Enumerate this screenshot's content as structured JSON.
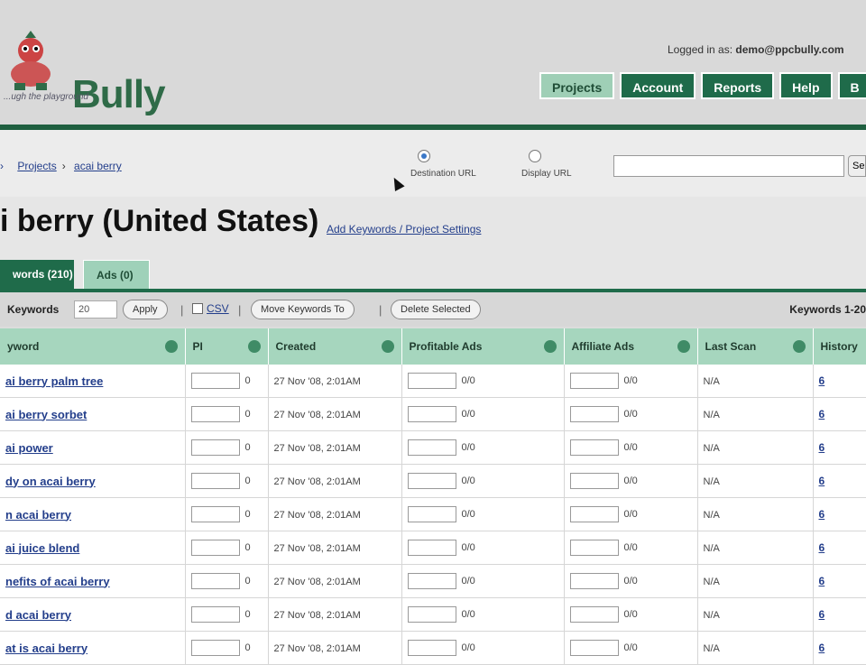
{
  "header": {
    "logo_text": "Bully",
    "logo_tagline": "...ugh the playground",
    "logged_in_label": "Logged in as:",
    "logged_in_user": "demo@ppcbully.com",
    "nav": [
      "Projects",
      "Account",
      "Reports",
      "Help",
      "B"
    ]
  },
  "breadcrumb": {
    "lead": "›",
    "items": [
      "Projects",
      "acai berry"
    ]
  },
  "url_options": {
    "destination_label": "Destination URL",
    "display_label": "Display URL",
    "selected": "Destination URL"
  },
  "search": {
    "placeholder": "",
    "button_label": "Se"
  },
  "page": {
    "title": "i berry (United States)",
    "settings_link": "Add Keywords / Project Settings"
  },
  "tabs": [
    {
      "label": "words (210)",
      "active": true
    },
    {
      "label": "Ads (0)",
      "active": false
    }
  ],
  "toolbar": {
    "keywords_label": "Keywords",
    "per_page_value": "20",
    "apply_label": "Apply",
    "csv_label": "CSV",
    "move_label": "Move Keywords To",
    "delete_label": "Delete Selected",
    "count_label": "Keywords 1-20"
  },
  "table": {
    "columns": [
      "yword",
      "PI",
      "Created",
      "Profitable Ads",
      "Affiliate Ads",
      "Last Scan",
      "History"
    ],
    "rows": [
      {
        "keyword": "ai berry palm tree",
        "pi": "0",
        "created": "27 Nov '08, 2:01AM",
        "profitable": "0/0",
        "affiliate": "0/0",
        "last_scan": "N/A",
        "history": "6"
      },
      {
        "keyword": "ai berry sorbet",
        "pi": "0",
        "created": "27 Nov '08, 2:01AM",
        "profitable": "0/0",
        "affiliate": "0/0",
        "last_scan": "N/A",
        "history": "6"
      },
      {
        "keyword": "ai power",
        "pi": "0",
        "created": "27 Nov '08, 2:01AM",
        "profitable": "0/0",
        "affiliate": "0/0",
        "last_scan": "N/A",
        "history": "6"
      },
      {
        "keyword": "dy on acai berry",
        "pi": "0",
        "created": "27 Nov '08, 2:01AM",
        "profitable": "0/0",
        "affiliate": "0/0",
        "last_scan": "N/A",
        "history": "6"
      },
      {
        "keyword": "n acai berry",
        "pi": "0",
        "created": "27 Nov '08, 2:01AM",
        "profitable": "0/0",
        "affiliate": "0/0",
        "last_scan": "N/A",
        "history": "6"
      },
      {
        "keyword": "ai juice blend",
        "pi": "0",
        "created": "27 Nov '08, 2:01AM",
        "profitable": "0/0",
        "affiliate": "0/0",
        "last_scan": "N/A",
        "history": "6"
      },
      {
        "keyword": "nefits of acai berry",
        "pi": "0",
        "created": "27 Nov '08, 2:01AM",
        "profitable": "0/0",
        "affiliate": "0/0",
        "last_scan": "N/A",
        "history": "6"
      },
      {
        "keyword": "d acai berry",
        "pi": "0",
        "created": "27 Nov '08, 2:01AM",
        "profitable": "0/0",
        "affiliate": "0/0",
        "last_scan": "N/A",
        "history": "6"
      },
      {
        "keyword": "at is acai berry",
        "pi": "0",
        "created": "27 Nov '08, 2:01AM",
        "profitable": "0/0",
        "affiliate": "0/0",
        "last_scan": "N/A",
        "history": "6"
      }
    ]
  }
}
